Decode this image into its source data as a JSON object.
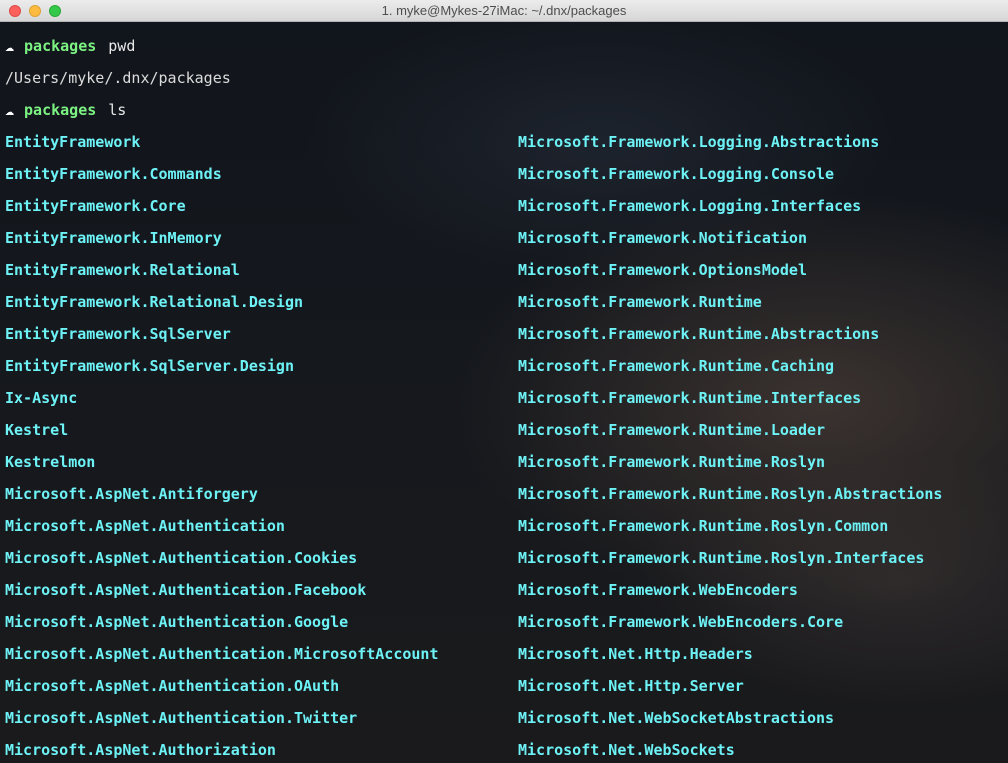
{
  "window": {
    "title": "1. myke@Mykes-27iMac: ~/.dnx/packages"
  },
  "terminal": {
    "prompt_icon": "☁",
    "commands": [
      {
        "dir": "packages",
        "cmd": "pwd"
      },
      {
        "dir": "packages",
        "cmd": "ls"
      }
    ],
    "pwd_output": "/Users/myke/.dnx/packages",
    "ls_left": [
      "EntityFramework",
      "EntityFramework.Commands",
      "EntityFramework.Core",
      "EntityFramework.InMemory",
      "EntityFramework.Relational",
      "EntityFramework.Relational.Design",
      "EntityFramework.SqlServer",
      "EntityFramework.SqlServer.Design",
      "Ix-Async",
      "Kestrel",
      "Kestrelmon",
      "Microsoft.AspNet.Antiforgery",
      "Microsoft.AspNet.Authentication",
      "Microsoft.AspNet.Authentication.Cookies",
      "Microsoft.AspNet.Authentication.Facebook",
      "Microsoft.AspNet.Authentication.Google",
      "Microsoft.AspNet.Authentication.MicrosoftAccount",
      "Microsoft.AspNet.Authentication.OAuth",
      "Microsoft.AspNet.Authentication.Twitter",
      "Microsoft.AspNet.Authorization"
    ],
    "ls_right": [
      "Microsoft.Framework.Logging.Abstractions",
      "Microsoft.Framework.Logging.Console",
      "Microsoft.Framework.Logging.Interfaces",
      "Microsoft.Framework.Notification",
      "Microsoft.Framework.OptionsModel",
      "Microsoft.Framework.Runtime",
      "Microsoft.Framework.Runtime.Abstractions",
      "Microsoft.Framework.Runtime.Caching",
      "Microsoft.Framework.Runtime.Interfaces",
      "Microsoft.Framework.Runtime.Loader",
      "Microsoft.Framework.Runtime.Roslyn",
      "Microsoft.Framework.Runtime.Roslyn.Abstractions",
      "Microsoft.Framework.Runtime.Roslyn.Common",
      "Microsoft.Framework.Runtime.Roslyn.Interfaces",
      "Microsoft.Framework.WebEncoders",
      "Microsoft.Framework.WebEncoders.Core",
      "Microsoft.Net.Http.Headers",
      "Microsoft.Net.Http.Server",
      "Microsoft.Net.WebSocketAbstractions",
      "Microsoft.Net.WebSockets"
    ]
  },
  "colors": {
    "prompt_dir": "#7cf283",
    "directory_listing": "#6df2f6",
    "text": "#dcdcdc",
    "close_button": "#fc605c",
    "minimize_button": "#fdbc40",
    "maximize_button": "#34c84a"
  }
}
